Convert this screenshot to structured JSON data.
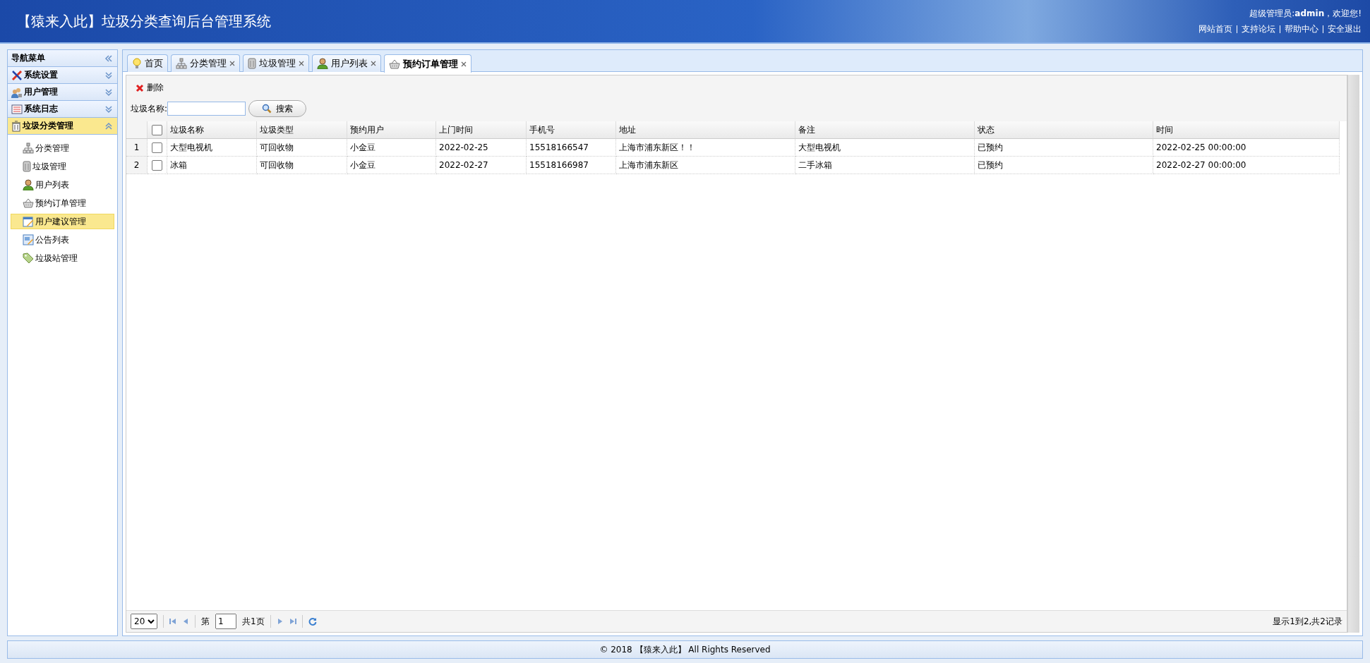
{
  "header": {
    "title": "【猿来入此】垃圾分类查询后台管理系统",
    "greeting": "超级管理员:**admin**，欢迎您!",
    "links": [
      "网站首页",
      "支持论坛",
      "帮助中心",
      "安全退出"
    ]
  },
  "sidebar": {
    "title": "导航菜单",
    "groups": [
      {
        "label": "系统设置",
        "expanded": false
      },
      {
        "label": "用户管理",
        "expanded": false
      },
      {
        "label": "系统日志",
        "expanded": false
      },
      {
        "label": "垃圾分类管理",
        "expanded": true,
        "items": [
          {
            "label": "分类管理",
            "selected": false
          },
          {
            "label": "垃圾管理",
            "selected": false
          },
          {
            "label": "用户列表",
            "selected": false
          },
          {
            "label": "预约订单管理",
            "selected": false
          },
          {
            "label": "用户建议管理",
            "selected": true
          },
          {
            "label": "公告列表",
            "selected": false
          },
          {
            "label": "垃圾站管理",
            "selected": false
          }
        ]
      }
    ]
  },
  "tabs": [
    {
      "label": "首页",
      "closable": false,
      "selected": false
    },
    {
      "label": "分类管理",
      "closable": true,
      "selected": false
    },
    {
      "label": "垃圾管理",
      "closable": true,
      "selected": false
    },
    {
      "label": "用户列表",
      "closable": true,
      "selected": false
    },
    {
      "label": "预约订单管理",
      "closable": true,
      "selected": true
    }
  ],
  "toolbar": {
    "delete_button": "删除"
  },
  "search": {
    "label": "垃圾名称:",
    "button": "搜索"
  },
  "table": {
    "all_checked": false,
    "columns": [
      "垃圾名称",
      "垃圾类型",
      "预约用户",
      "上门时间",
      "手机号",
      "地址",
      "备注",
      "状态",
      "时间"
    ],
    "rows": [
      {
        "number": "1",
        "checked": false,
        "cells": [
          "大型电视机",
          "可回收物",
          "小金豆",
          "2022-02-25",
          "15518166547",
          "上海市浦东新区！！",
          "大型电视机",
          "已预约",
          "2022-02-25 00:00:00"
        ]
      },
      {
        "number": "2",
        "checked": false,
        "cells": [
          "冰箱",
          "可回收物",
          "小金豆",
          "2022-02-27",
          "15518166987",
          "上海市浦东新区",
          "二手冰箱",
          "已预约",
          "2022-02-27 00:00:00"
        ]
      }
    ]
  },
  "pager": {
    "page_size": "20",
    "page_prefix": "第",
    "page": "1",
    "page_total": "共1页",
    "summary": "显示1到2,共2记录"
  },
  "footer": "© 2018 【猿来入此】 All Rights Reserved"
}
